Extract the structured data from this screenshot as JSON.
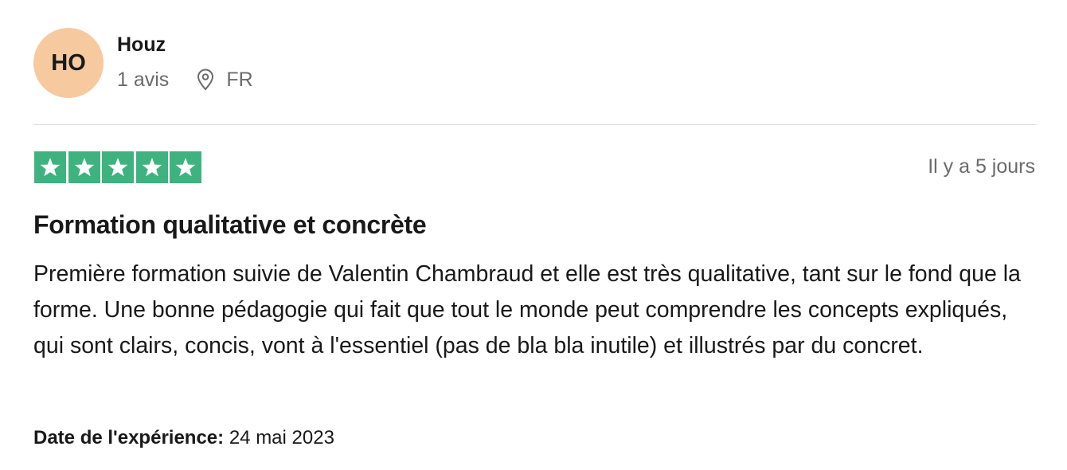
{
  "consumer": {
    "initials": "HO",
    "avatar_color": "#f7c99f",
    "name": "Houz",
    "review_count": "1 avis",
    "location_icon": "location-pin-icon",
    "country": "FR"
  },
  "review": {
    "rating": 5,
    "rating_max": 5,
    "star_color": "#3fb37f",
    "date_posted": "Il y a 5 jours",
    "title": "Formation qualitative et concrète",
    "body": "Première formation suivie de Valentin Chambraud et elle est très qualitative, tant sur le fond que la forme. Une bonne pédagogie qui fait que tout le monde peut comprendre les concepts expliqués, qui sont clairs, concis, vont à l'essentiel (pas de bla bla inutile) et illustrés par du concret.",
    "experience_label": "Date de l'expérience:",
    "experience_date": "24 mai 2023"
  }
}
